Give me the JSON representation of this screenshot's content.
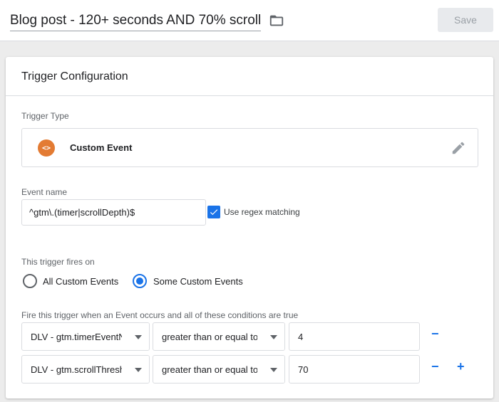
{
  "header": {
    "tag_name": "Blog post - 120+ seconds AND 70% scroll",
    "save_label": "Save"
  },
  "card": {
    "title": "Trigger Configuration",
    "trigger_type": {
      "label": "Trigger Type",
      "name": "Custom Event",
      "icon": "code-brackets-icon",
      "icon_text": "<>",
      "icon_color": "#e37b33"
    },
    "event_name": {
      "label": "Event name",
      "value": "^gtm\\.(timer|scrollDepth)$",
      "regex_label": "Use regex matching",
      "regex_checked": true
    },
    "fires_on": {
      "label": "This trigger fires on",
      "options": [
        "All Custom Events",
        "Some Custom Events"
      ],
      "selected": "Some Custom Events"
    },
    "conditions": {
      "label": "Fire this trigger when an Event occurs and all of these conditions are true",
      "rows": [
        {
          "variable": "DLV - gtm.timerEventNumber",
          "operator": "greater than or equal to",
          "value": "4"
        },
        {
          "variable": "DLV - gtm.scrollThreshold",
          "operator": "greater than or equal to",
          "value": "70"
        }
      ],
      "remove_symbol": "−",
      "add_symbol": "+"
    }
  },
  "colors": {
    "accent": "#1a73e8",
    "border": "#dadce0"
  }
}
